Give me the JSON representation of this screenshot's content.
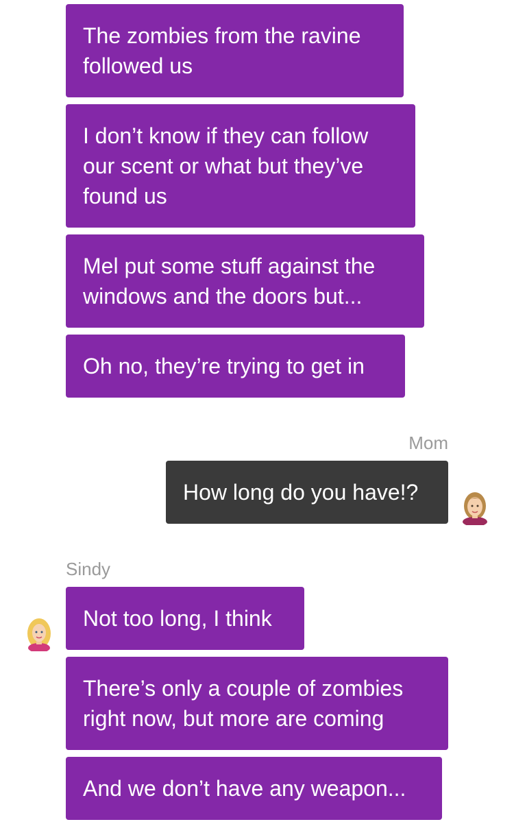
{
  "chat": {
    "messages": [
      {
        "text": "The zombies from the ravine\nfollowed us"
      },
      {
        "text": "I don’t know if they can follow\nour scent or what but they’ve\nfound us"
      },
      {
        "text": "Mel put some stuff against the\nwindows and the doors but..."
      },
      {
        "text": "Oh no, they’re trying to get in"
      },
      {
        "sender": "Mom",
        "text": "How long do you have!?"
      },
      {
        "sender": "Sindy",
        "text": "Not too long, I think"
      },
      {
        "text": "There’s only a couple of zombies\nright now, but more are coming"
      },
      {
        "text": "And we don’t have any weapon..."
      }
    ]
  },
  "colors": {
    "incoming_bubble": "#8428a8",
    "outgoing_bubble": "#3a3a3a",
    "sender_label": "#9a9a9a"
  },
  "icons": {
    "mom_avatar": "mom-avatar-icon",
    "sindy_avatar": "sindy-avatar-icon"
  }
}
